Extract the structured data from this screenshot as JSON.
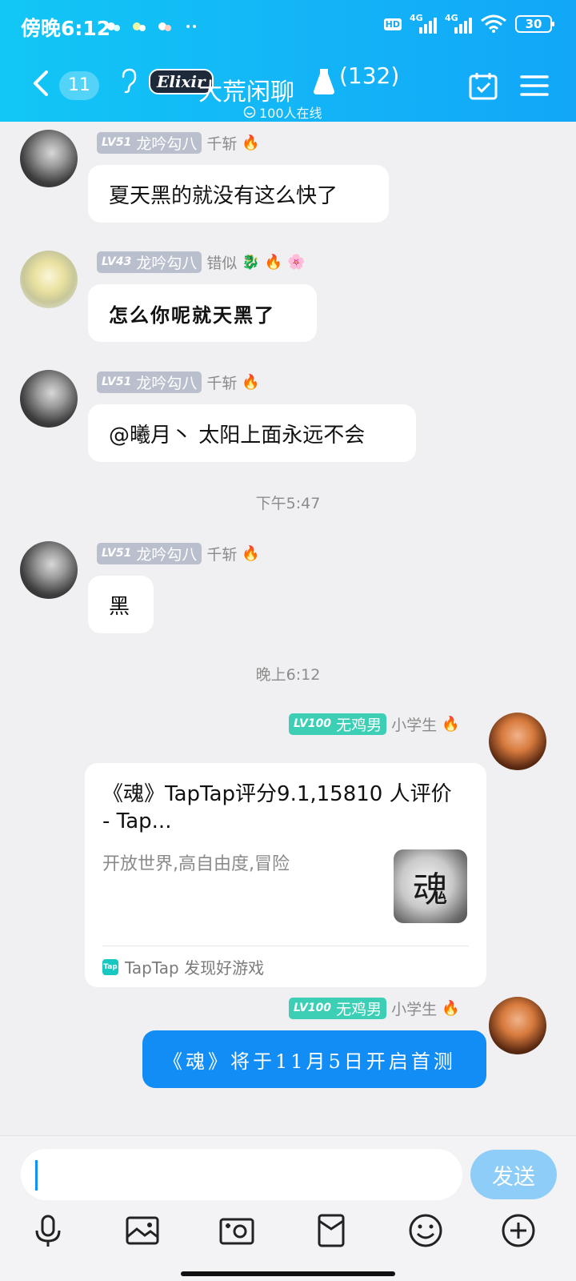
{
  "status_bar": {
    "time": "傍晚6:12",
    "network_1": "4G",
    "network_2": "4G",
    "hd": "HD",
    "battery": "30"
  },
  "header": {
    "unread_count": "11",
    "logo_text": "Elixir",
    "group_name": "大荒闲聊",
    "member_count": "(132)",
    "online_text": "100人在线"
  },
  "messages": [
    {
      "level": "LV51",
      "nickname": "龙吟勾八",
      "title": "千斩",
      "text": "夏天黑的就没有这么快了"
    },
    {
      "level": "LV43",
      "nickname": "龙吟勾八",
      "title": "错似",
      "text": "怎么你呢就天黑了"
    },
    {
      "level": "LV51",
      "nickname": "龙吟勾八",
      "title": "千斩",
      "text": "@曦月丶 太阳上面永远不会"
    },
    {
      "level": "LV51",
      "nickname": "龙吟勾八",
      "title": "千斩",
      "text": "黑"
    },
    {
      "level": "LV100",
      "nickname": "无鸡男",
      "title": "小学生"
    },
    {
      "level": "LV100",
      "nickname": "无鸡男",
      "title": "小学生",
      "text": "《魂》将于11月5日开启首测"
    }
  ],
  "time_separators": [
    "下午5:47",
    "晚上6:12"
  ],
  "share_card": {
    "title": "《魂》TapTap评分9.1,15810 人评价 - Tap...",
    "description": "开放世界,高自由度,冒险",
    "thumb_char": "魂",
    "source_icon": "Tap",
    "source": "TapTap 发现好游戏"
  },
  "input": {
    "placeholder": "",
    "send_label": "发送"
  },
  "toolbar_icons": [
    "microphone-icon",
    "image-icon",
    "camera-icon",
    "red-packet-icon",
    "emoji-icon",
    "plus-icon"
  ],
  "colors": {
    "header_start": "#12c7f5",
    "header_end": "#12a7f8",
    "bubble_self": "#118df5",
    "send_button": "#8dcdf7",
    "level_gray": "#b9bfcc",
    "level_teal": "#3ccfb6"
  }
}
